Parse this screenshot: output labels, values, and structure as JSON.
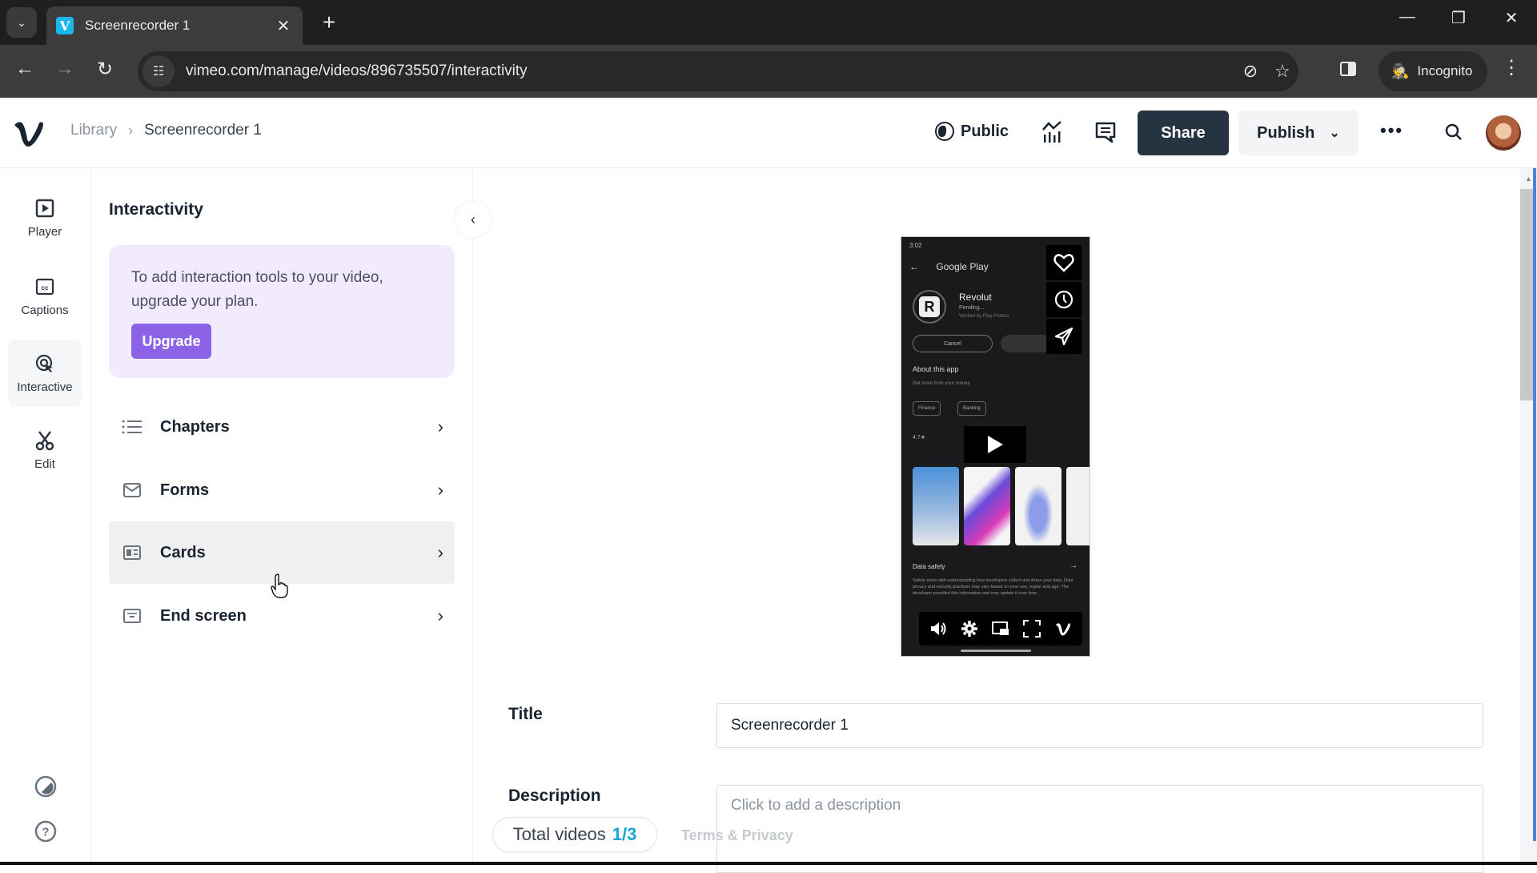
{
  "browser": {
    "tab_title": "Screenrecorder 1",
    "favicon_letter": "V",
    "url": "vimeo.com/manage/videos/896735507/interactivity",
    "incognito_label": "Incognito"
  },
  "header": {
    "breadcrumb": [
      {
        "label": "Library"
      },
      {
        "label": "Screenrecorder 1"
      }
    ],
    "privacy_label": "Public",
    "share_label": "Share",
    "publish_label": "Publish",
    "colors": {
      "share_bg": "#263340",
      "upgrade": "#8c63e6",
      "accent": "#17a5d8"
    }
  },
  "rail": {
    "items": [
      {
        "label": "Player",
        "icon": "player-icon",
        "active": false
      },
      {
        "label": "Captions",
        "icon": "captions-icon",
        "active": false
      },
      {
        "label": "Interactive",
        "icon": "interactive-icon",
        "active": true
      },
      {
        "label": "Edit",
        "icon": "scissors-icon",
        "active": false
      }
    ]
  },
  "panel": {
    "title": "Interactivity",
    "upgrade_text": "To add interaction tools to your video, upgrade your plan.",
    "upgrade_button": "Upgrade",
    "items": [
      {
        "label": "Chapters",
        "icon": "list-icon"
      },
      {
        "label": "Forms",
        "icon": "mail-icon"
      },
      {
        "label": "Cards",
        "icon": "card-icon"
      },
      {
        "label": "End screen",
        "icon": "end-screen-icon"
      }
    ]
  },
  "video_preview": {
    "status_time": "3:02",
    "store_title": "Google Play",
    "app_name": "Revolut",
    "app_status": "Pending...",
    "app_verified": "Verified by Play Protect",
    "cancel_label": "Cancel",
    "about_title": "About this app",
    "about_sub": "Get more from your money",
    "chips": [
      "Finance",
      "Banking"
    ],
    "rating": "4.7★",
    "data_safety_title": "Data safety",
    "data_safety_text": "Safety starts with understanding how developers collect and share your data. Data privacy and security practices may vary based on your use, region and age. The developer provided this information and may update it over time."
  },
  "details": {
    "title_label": "Title",
    "title_value": "Screenrecorder 1",
    "description_label": "Description",
    "description_placeholder": "Click to add a description"
  },
  "footer": {
    "total_videos_label": "Total videos",
    "total_videos_count": "1/3",
    "terms_label": "Terms & Privacy"
  }
}
